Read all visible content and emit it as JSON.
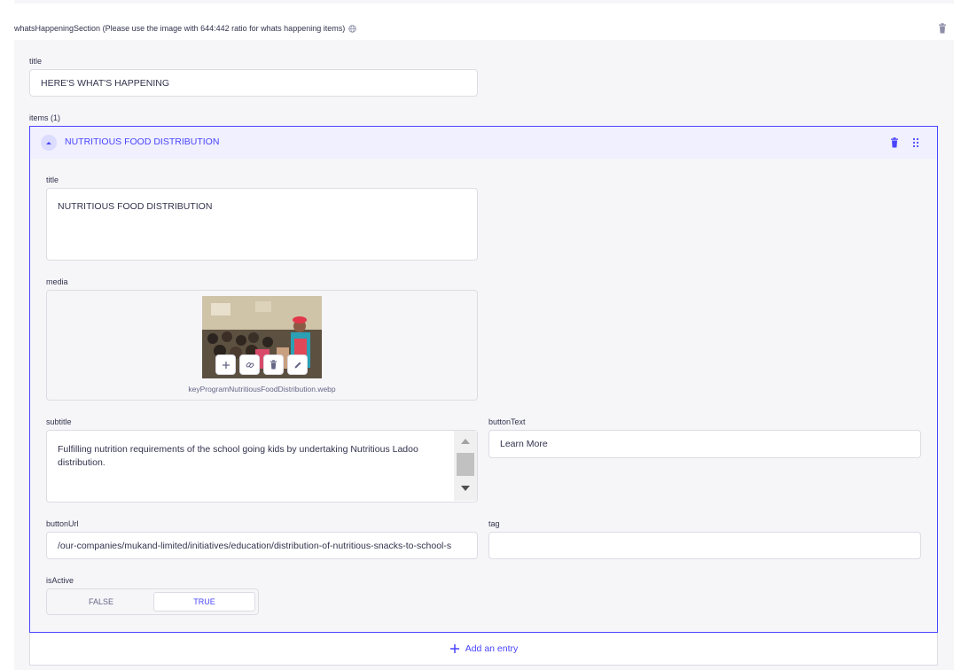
{
  "section": {
    "header": "whatsHappeningSection (Please use the image with 644:442 ratio for whats happening items)",
    "title_label": "title",
    "title_value": "HERE'S WHAT'S HAPPENING",
    "items_label": "items (1)"
  },
  "item": {
    "header_title": "NUTRITIOUS FOOD DISTRIBUTION",
    "title_label": "title",
    "title_value": "NUTRITIOUS FOOD DISTRIBUTION",
    "media_label": "media",
    "media_filename": "keyProgramNutritiousFoodDistribution.webp",
    "subtitle_label": "subtitle",
    "subtitle_value": "Fulfilling nutrition requirements of the school going kids by undertaking Nutritious Ladoo distribution.",
    "buttonText_label": "buttonText",
    "buttonText_value": "Learn More",
    "buttonUrl_label": "buttonUrl",
    "buttonUrl_value": "/our-companies/mukand-limited/initiatives/education/distribution-of-nutritious-snacks-to-school-s",
    "tag_label": "tag",
    "tag_value": "",
    "isActive_label": "isActive",
    "isActive_false": "FALSE",
    "isActive_true": "TRUE"
  },
  "add_entry_label": "Add an entry",
  "colors": {
    "accent": "#4945ff",
    "background": "#f6f6f9",
    "border": "#dcdce4"
  }
}
